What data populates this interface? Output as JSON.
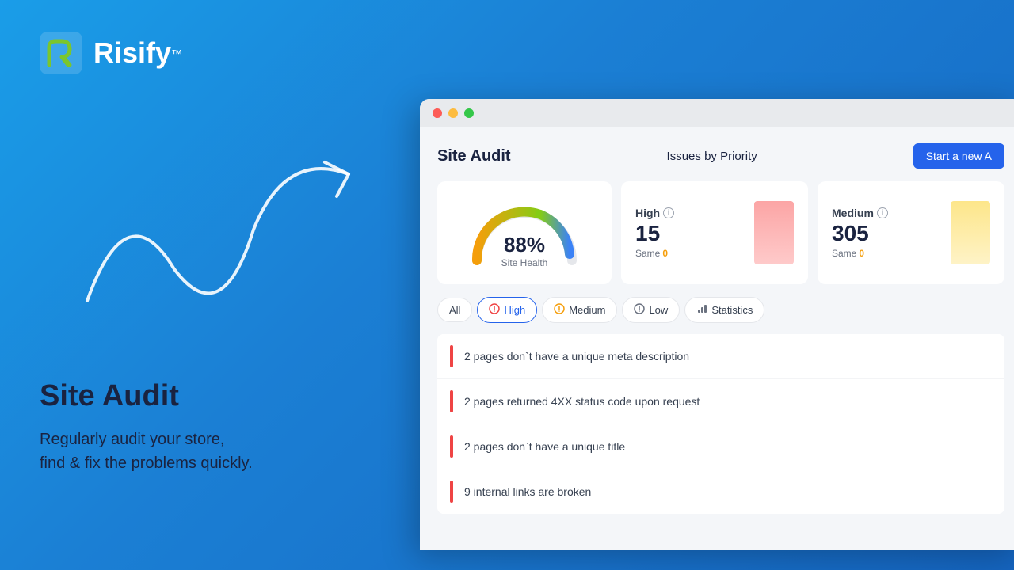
{
  "brand": {
    "name": "Risify",
    "tm": "™"
  },
  "left": {
    "heading": "Site Audit",
    "description": "Regularly audit your store,\nfind & fix the problems quickly."
  },
  "browser": {
    "audit_title": "Site Audit",
    "issues_label": "Issues by Priority",
    "start_new_btn": "Start a new A",
    "gauge": {
      "percent": "88%",
      "label": "Site Health"
    },
    "priority_cards": [
      {
        "type": "High",
        "count": "15",
        "same_label": "Same",
        "same_value": "0",
        "bar_class": "priority-bar-high"
      },
      {
        "type": "Medium",
        "count": "305",
        "same_label": "Same",
        "same_value": "0",
        "bar_class": "priority-bar-medium"
      }
    ],
    "tabs": [
      {
        "label": "All",
        "active": false,
        "icon": "none"
      },
      {
        "label": "High",
        "active": true,
        "icon": "circle-x"
      },
      {
        "label": "Medium",
        "active": false,
        "icon": "circle-alert"
      },
      {
        "label": "Low",
        "active": false,
        "icon": "circle-info"
      },
      {
        "label": "Statistics",
        "active": false,
        "icon": "bar-chart"
      }
    ],
    "issues": [
      "2 pages don`t have a unique meta description",
      "2 pages returned 4XX status code upon request",
      "2 pages don`t have a unique title",
      "9 internal links are broken"
    ]
  }
}
